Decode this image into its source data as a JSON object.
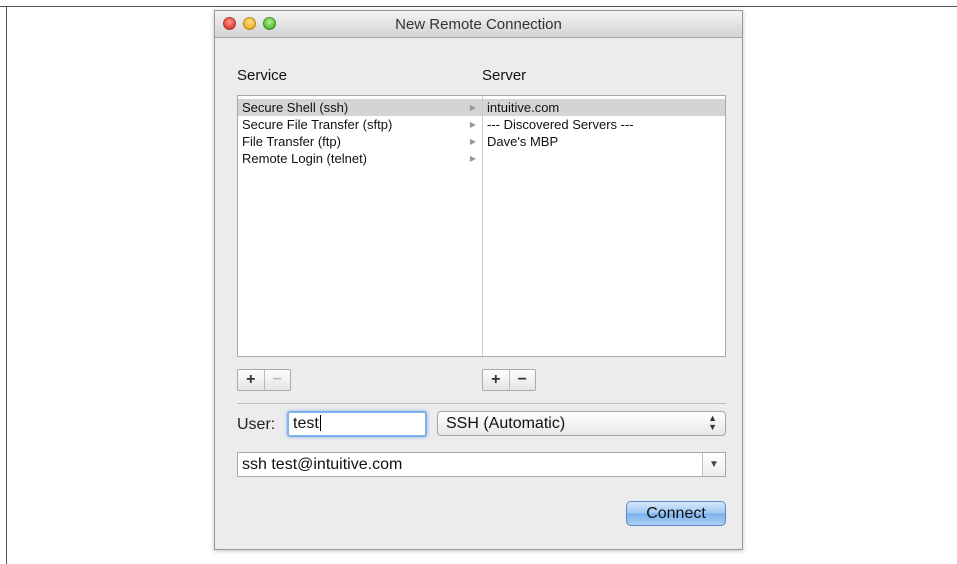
{
  "window": {
    "title": "New Remote Connection"
  },
  "columns": {
    "service_header": "Service",
    "server_header": "Server"
  },
  "services": [
    {
      "label": "Secure Shell (ssh)",
      "selected": true
    },
    {
      "label": "Secure File Transfer (sftp)",
      "selected": false
    },
    {
      "label": "File Transfer (ftp)",
      "selected": false
    },
    {
      "label": "Remote Login (telnet)",
      "selected": false
    }
  ],
  "servers": [
    {
      "label": "intuitive.com",
      "selected": true
    },
    {
      "label": "--- Discovered Servers ---",
      "selected": false
    },
    {
      "label": "Dave's MBP",
      "selected": false
    }
  ],
  "buttons": {
    "add": "+",
    "remove": "−",
    "connect": "Connect"
  },
  "user": {
    "label": "User:",
    "value": "test"
  },
  "protocol_popup": {
    "selected": "SSH (Automatic)"
  },
  "command": {
    "value": "ssh test@intuitive.com"
  },
  "icons": {
    "arrow": "▶",
    "stepper_up": "▲",
    "stepper_down": "▼",
    "dropdown": "▼"
  }
}
